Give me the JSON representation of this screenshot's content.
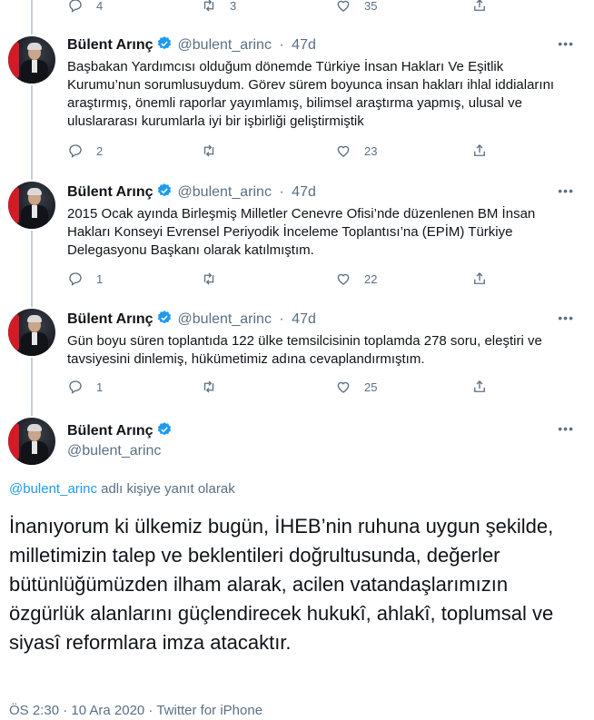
{
  "top_actions": {
    "replies": "4",
    "retweets": "3",
    "likes": "35"
  },
  "author": {
    "name": "Bülent Arınç",
    "handle": "@bulent_arinc"
  },
  "tweets": [
    {
      "time": "47d",
      "text": "Başbakan Yardımcısı olduğum dönemde Türkiye İnsan Hakları Ve Eşitlik Kurumu’nun sorumlusuydum. Görev sürem boyunca insan hakları ihlal iddialarını araştırmış, önemli raporlar yayımlamış, bilimsel araştırma yapmış, ulusal ve uluslararası kurumlarla iyi bir işbirliği geliştirmiştik",
      "replies": "2",
      "retweets": "",
      "likes": "23"
    },
    {
      "time": "47d",
      "text": "2015 Ocak ayında Birleşmiş Milletler Cenevre Ofisi’nde düzenlenen BM İnsan Hakları Konseyi Evrensel Periyodik İnceleme Toplantısı’na (EPİM) Türkiye Delegasyonu Başkanı olarak katılmıştım.",
      "replies": "1",
      "retweets": "",
      "likes": "22"
    },
    {
      "time": "47d",
      "text": "Gün boyu süren toplantıda 122 ülke temsilcisinin toplamda 278 soru, eleştiri ve tavsiyesini dinlemiş, hükümetimiz adına cevaplandırmıştım.",
      "replies": "1",
      "retweets": "",
      "likes": "25"
    }
  ],
  "main": {
    "reply_prefix": "@bulent_arinc",
    "reply_suffix": " adlı kişiye yanıt olarak",
    "text": "İnanıyorum ki ülkemiz bugün, İHEB’nin ruhuna uygun şekilde, milletimizin talep ve beklentileri doğrultusunda, değerler bütünlüğümüzden ilham alarak, acilen vatandaşlarımızın özgürlük alanlarını güçlendirecek hukukî, ahlakî, toplumsal ve siyasî reformlara imza atacaktır.",
    "meta": "ÖS 2:30 · 10 Ara 2020 · Twitter for iPhone"
  },
  "colors": {
    "accent": "#1d9bf0",
    "muted": "#5b7083",
    "thread": "#c4cfd6"
  },
  "icons": [
    "reply-icon",
    "retweet-icon",
    "like-icon",
    "share-icon",
    "verified-icon",
    "more-icon"
  ]
}
